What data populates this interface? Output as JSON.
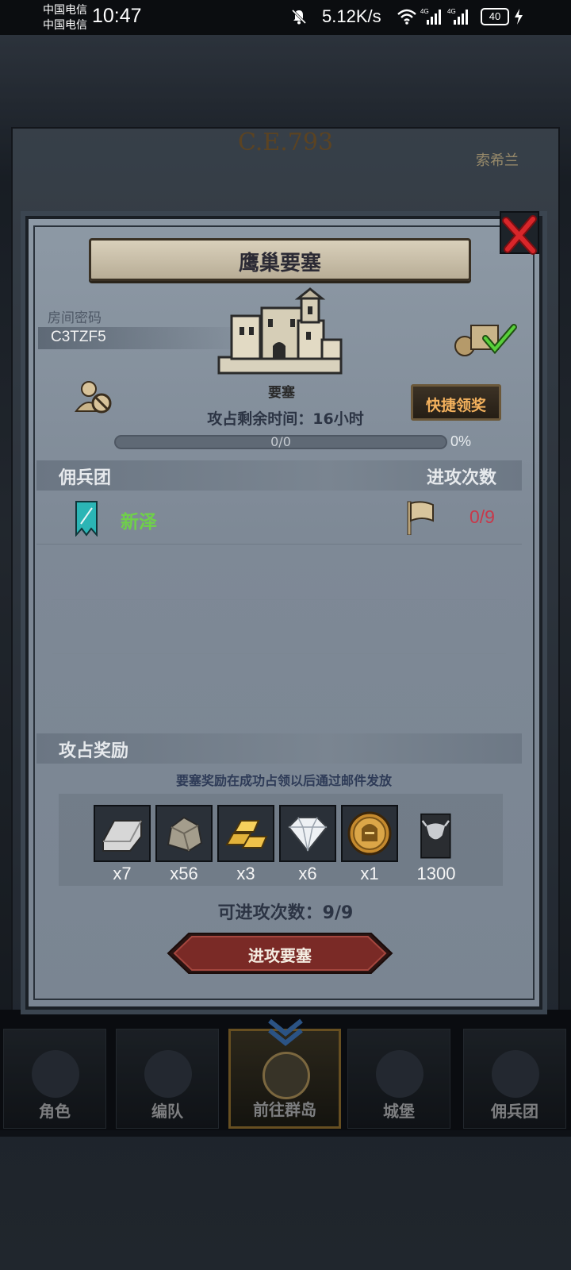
{
  "status_bar": {
    "carrier_1": "中国电信",
    "carrier_2": "中国电信",
    "time": "10:47",
    "net_speed": "5.12K/s",
    "battery": "40",
    "icons": [
      "mute-bell-icon",
      "wifi-icon",
      "signal-4g-icon",
      "signal-4g-icon",
      "battery-icon",
      "charging-bolt-icon"
    ]
  },
  "background": {
    "era_label": "C.E.793",
    "side_label": "索希兰"
  },
  "modal": {
    "title": "鹰巢要塞",
    "room_password_label": "房间密码",
    "room_code": "C3TZF5",
    "fortress_label": "要塞",
    "quick_reward_label": "快捷领奖",
    "time_left": "攻占剩余时间：16小时",
    "progress_text": "0/0",
    "progress_percent": "0%",
    "progress_fraction": 0,
    "mercenary_header": "佣兵团",
    "attack_count_header": "进攻次数",
    "mercenary_rows": [
      {
        "name": "新泽",
        "count": "0/9"
      }
    ],
    "reward_header": "攻占奖励",
    "reward_note": "要塞奖励在成功占领以后通过邮件发放",
    "rewards": [
      {
        "icon": "silver-ingot-icon",
        "qty": "x7"
      },
      {
        "icon": "stone-ore-icon",
        "qty": "x56"
      },
      {
        "icon": "gold-bars-icon",
        "qty": "x3"
      },
      {
        "icon": "diamond-icon",
        "qty": "x6"
      },
      {
        "icon": "knight-helmet-coin-icon",
        "qty": "x1"
      },
      {
        "icon": "bull-banner-icon",
        "qty": "1300"
      }
    ],
    "attack_quota": "可进攻次数：9/9",
    "attack_button_label": "进攻要塞"
  },
  "bottom_nav": {
    "items": [
      {
        "label": "角色",
        "icon": "knight-icon"
      },
      {
        "label": "编队",
        "icon": "formation-helmet-icon"
      },
      {
        "label": "前往群岛",
        "icon": "globe-icon",
        "active": true
      },
      {
        "label": "城堡",
        "icon": "castle-icon"
      },
      {
        "label": "佣兵团",
        "icon": "mercenary-icon"
      }
    ]
  },
  "colors": {
    "mercenary_name": "#6fd04a",
    "attack_count": "#c8384a",
    "quick_reward_text": "#f3b15d",
    "attack_button": "#7a2a26"
  }
}
